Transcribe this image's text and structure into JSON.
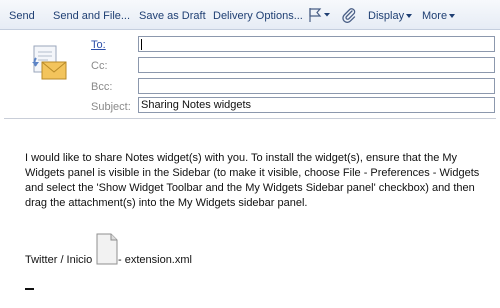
{
  "toolbar": {
    "send": "Send",
    "send_and_file": "Send and File...",
    "save_as_draft": "Save as Draft",
    "delivery_options": "Delivery Options...",
    "display": "Display",
    "more": "More"
  },
  "fields": {
    "to_label": "To:",
    "to_value": "",
    "cc_label": "Cc:",
    "cc_value": "",
    "bcc_label": "Bcc:",
    "bcc_value": "",
    "subject_label": "Subject:",
    "subject_value": "Sharing Notes widgets"
  },
  "body": {
    "message": "I would like to share Notes widget(s) with you. To install the widget(s), ensure that the My Widgets panel is visible in the Sidebar (to make it visible,  choose File - Preferences - Widgets and select the 'Show Widget Toolbar and the My Widgets Sidebar panel' checkbox) and then drag the attachment(s) into the My Widgets sidebar panel.",
    "attachment_prefix": "Twitter / Inicio",
    "attachment_suffix": " - extension.xml"
  },
  "icons": {
    "flag": "flag-icon",
    "paperclip": "paperclip-icon",
    "envelope": "envelope-icon",
    "document": "document-icon"
  },
  "colors": {
    "toolbar_text": "#1f3f73",
    "link_label": "#2d4fa8",
    "field_border": "#8c98ad"
  }
}
